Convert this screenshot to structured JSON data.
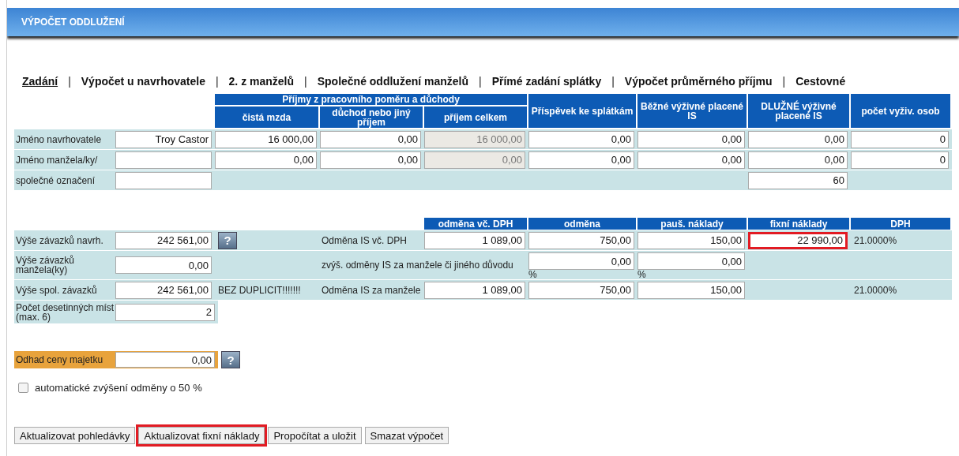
{
  "title": "VÝPOČET ODDLUŽENÍ",
  "tabs": [
    {
      "label": "Zadání",
      "selected": true
    },
    {
      "label": "Výpočet u navrhovatele",
      "selected": false
    },
    {
      "label": "2. z manželů",
      "selected": false
    },
    {
      "label": "Společné oddlužení manželů",
      "selected": false
    },
    {
      "label": "Přímé zadání splátky",
      "selected": false
    },
    {
      "label": "Výpočet průměrného příjmu",
      "selected": false
    },
    {
      "label": "Cestovné",
      "selected": false
    }
  ],
  "tab_separator": "|",
  "income_table": {
    "column_group": {
      "label": "Příjmy z pracovního poměru a důchody",
      "columns": [
        {
          "label": "čistá mzda",
          "readonly": false
        },
        {
          "label": "důchod nebo jiný příjem",
          "readonly": false
        },
        {
          "label": "příjem celkem",
          "readonly": true
        }
      ]
    },
    "columns": [
      {
        "label": "Příspěvek ke splátkám",
        "readonly": false
      },
      {
        "label": "Běžné výživné placené IS",
        "readonly": false
      },
      {
        "label": "DLUŽNÉ výživné placené IS",
        "readonly": false
      },
      {
        "label": "počet vyživ. osob",
        "readonly": false
      }
    ],
    "rows": [
      {
        "label": "Jméno navrhovatele",
        "name": "Troy Castor",
        "values": [
          "16 000,00",
          "0,00",
          "16 000,00",
          "0,00",
          "0,00",
          "0,00",
          "0"
        ]
      },
      {
        "label": "Jméno manžela/ky/",
        "values": [
          "0,00",
          "0,00",
          "0,00",
          "0,00",
          "0,00",
          "0,00",
          "0"
        ]
      }
    ],
    "shared_row": {
      "label": "společné označení",
      "owed_value": "60"
    }
  },
  "fees_table": {
    "columns": [
      "odměna vč. DPH",
      "odměna",
      "pauš. náklady",
      "fixní náklady",
      "DPH"
    ],
    "rows": [
      {
        "kind": "main",
        "label": "Výše závazků navrh.",
        "amount": "242 561,00",
        "help": "?",
        "fee_label": "Odměna IS vč. DPH",
        "values": [
          {
            "value": "1 089,00",
            "highlighted": false
          },
          {
            "value": "750,00",
            "highlighted": false
          },
          {
            "value": "150,00",
            "highlighted": false
          },
          {
            "value": "22 990,00",
            "highlighted": true
          }
        ],
        "vat": "21.0000%"
      },
      {
        "kind": "percent",
        "label": "Výše závazků manžela(ky)",
        "amount": "0,00",
        "fee_label": "zvýš. odměny IS za manžele či jiného důvodu",
        "values": [
          {
            "value": "0,00",
            "unit": "%",
            "highlighted": false
          },
          {
            "value": "0,00",
            "unit": "%",
            "highlighted": false
          }
        ]
      },
      {
        "kind": "main",
        "label": "Výše spol. závazků",
        "amount": "242 561,00",
        "note": "BEZ DUPLICIT!!!!!!!",
        "fee_label": "Odměna IS za manžele",
        "values": [
          {
            "value": "1 089,00",
            "highlighted": false
          },
          {
            "value": "750,00",
            "highlighted": false
          },
          {
            "value": "150,00",
            "highlighted": false
          }
        ],
        "vat": "21.0000%"
      }
    ],
    "decimals": {
      "label": "Počet desetinných míst (max. 6)",
      "value": "2"
    }
  },
  "estimate": {
    "label": "Odhad ceny majetku",
    "value": "0,00",
    "help": "?"
  },
  "auto_increase": {
    "label": "automatické zvýšení odměny o 50 %",
    "checked": false
  },
  "buttons": [
    {
      "label": "Aktualizovat pohledávky",
      "highlighted": false
    },
    {
      "label": "Aktualizovat fixní náklady",
      "highlighted": true
    },
    {
      "label": "Propočítat a uložit",
      "highlighted": false
    },
    {
      "label": "Smazat výpočet",
      "highlighted": false
    }
  ]
}
